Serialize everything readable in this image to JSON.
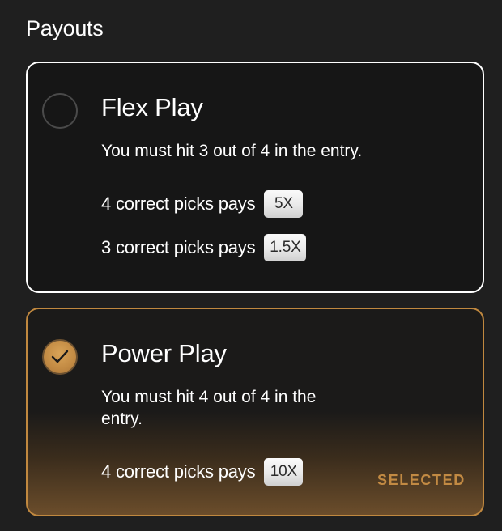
{
  "page": {
    "title": "Payouts"
  },
  "flex_play": {
    "title": "Flex Play",
    "description": "You must hit 3 out of 4 in the entry.",
    "selected": false,
    "payouts": [
      {
        "label": "4 correct picks pays",
        "multiplier": "5X"
      },
      {
        "label": "3 correct picks pays",
        "multiplier": "1.5X"
      }
    ]
  },
  "power_play": {
    "title": "Power Play",
    "description": "You must hit 4 out of 4 in the entry.",
    "selected": true,
    "status_label": "SELECTED",
    "payouts": [
      {
        "label": "4 correct picks pays",
        "multiplier": "10X"
      }
    ]
  },
  "icons": {
    "selected_indicator": "checkmark-icon"
  },
  "colors": {
    "background": "#1f1f1f",
    "accent": "#c28a43",
    "card_border": "#ffffff"
  }
}
